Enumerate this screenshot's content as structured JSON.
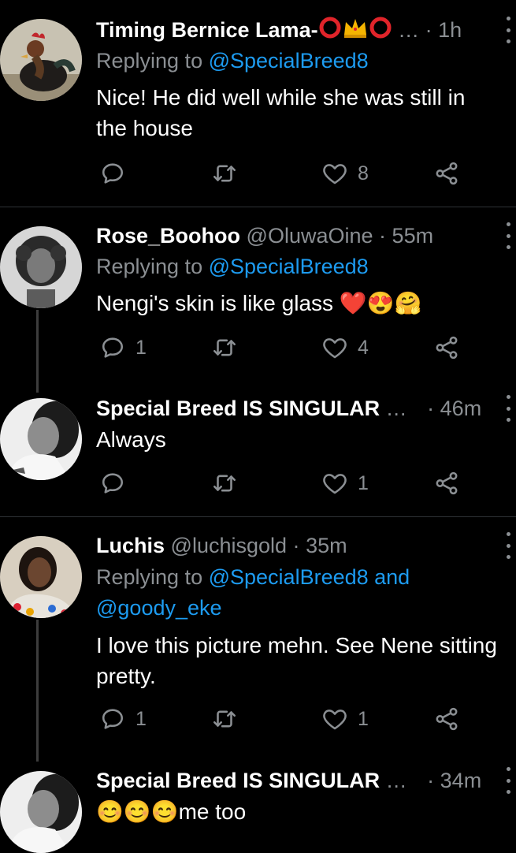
{
  "tweets": [
    {
      "name": "Timing Bernice Lama-",
      "handle": "…",
      "dot": "·",
      "time": "1h",
      "replying_prefix": "Replying to",
      "replying_to": "@SpecialBreed8",
      "text": "Nice! He did well while she was still in the house",
      "replies": "",
      "retweets": "",
      "likes": "8"
    },
    {
      "name": "Rose_Boohoo",
      "handle": "@OluwaOine",
      "dot": "·",
      "time": "55m",
      "replying_prefix": "Replying to",
      "replying_to": "@SpecialBreed8",
      "text": "Nengi's skin is like glass ❤️😍🤗",
      "replies": "1",
      "retweets": "",
      "likes": "4"
    },
    {
      "name": "Special Breed IS SINGULAR",
      "handle": "…",
      "dot": "·",
      "time": "46m",
      "text": "Always",
      "replies": "",
      "retweets": "",
      "likes": "1"
    },
    {
      "name": "Luchis",
      "handle": "@luchisgold",
      "dot": "·",
      "time": "35m",
      "replying_prefix": "Replying to",
      "replying_to": "@SpecialBreed8 and @goody_eke",
      "text": "I love this picture mehn. See Nene sitting pretty.",
      "replies": "1",
      "retweets": "",
      "likes": "1"
    },
    {
      "name": "Special Breed IS SINGULAR",
      "handle": "…",
      "dot": "·",
      "time": "34m",
      "text": "😊😊😊me too"
    }
  ],
  "icons": {
    "reply": "reply-icon",
    "retweet": "retweet-icon",
    "like": "heart-icon",
    "share": "share-icon",
    "more": "more-icon"
  },
  "colors": {
    "background": "#000000",
    "secondary_text": "#8b8f93",
    "link": "#1d9bf0",
    "badge_red": "#e0242a",
    "badge_gold": "#f5b400"
  }
}
